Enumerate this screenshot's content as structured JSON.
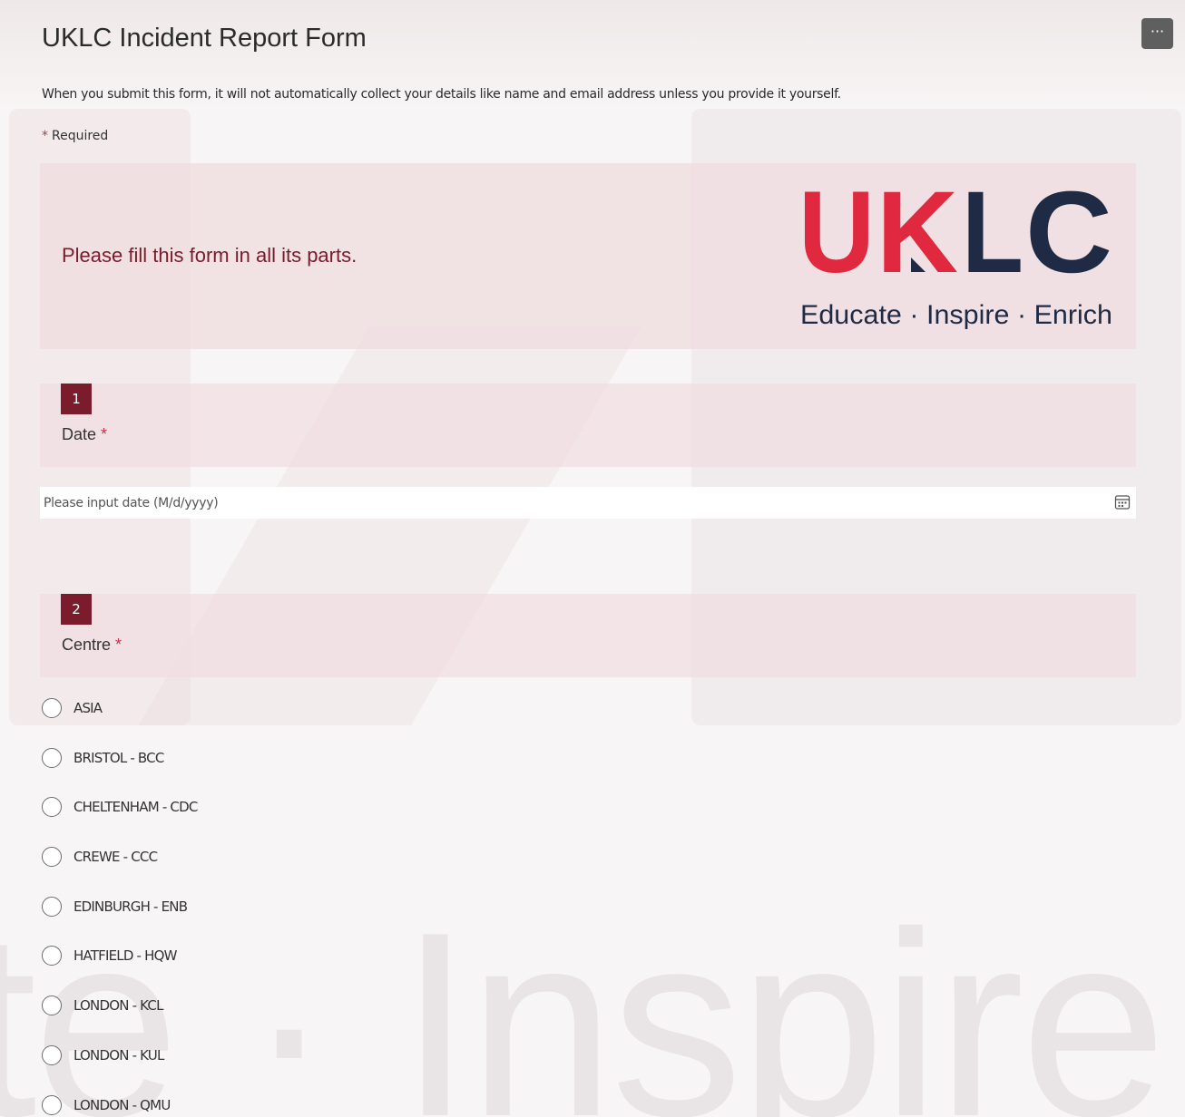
{
  "form": {
    "title": "UKLC Incident Report Form",
    "more_options_label": "···",
    "privacy_note": "When you submit this form, it will not automatically collect your details like name and email address unless you provide it yourself.",
    "required_marker": "*",
    "required_label": "Required"
  },
  "banner": {
    "text": "Please fill this form in all its parts.",
    "logo": {
      "letters": [
        "U",
        "K",
        "L",
        "C"
      ],
      "tagline": "Educate · Inspire · Enrich"
    }
  },
  "background": {
    "watermark": "te · Inspire ·"
  },
  "questions": [
    {
      "number": "1",
      "label": "Date",
      "required_marker": "*",
      "input": {
        "placeholder": "Please input date (M/d/yyyy)",
        "value": "",
        "icon": "calendar-icon"
      }
    },
    {
      "number": "2",
      "label": "Centre",
      "required_marker": "*",
      "options": [
        "ASIA",
        "BRISTOL - BCC",
        "CHELTENHAM - CDC",
        "CREWE - CCC",
        "EDINBURGH - ENB",
        "HATFIELD - HQW",
        "LONDON - KCL",
        "LONDON - KUL",
        "LONDON - QMU"
      ],
      "selected": null
    }
  ],
  "colors": {
    "accent": "#7a1c2c",
    "required": "#c4314b",
    "logo_red": "#e0283e",
    "logo_navy": "#1f2a44",
    "banner_bg": "#f0dee1"
  }
}
